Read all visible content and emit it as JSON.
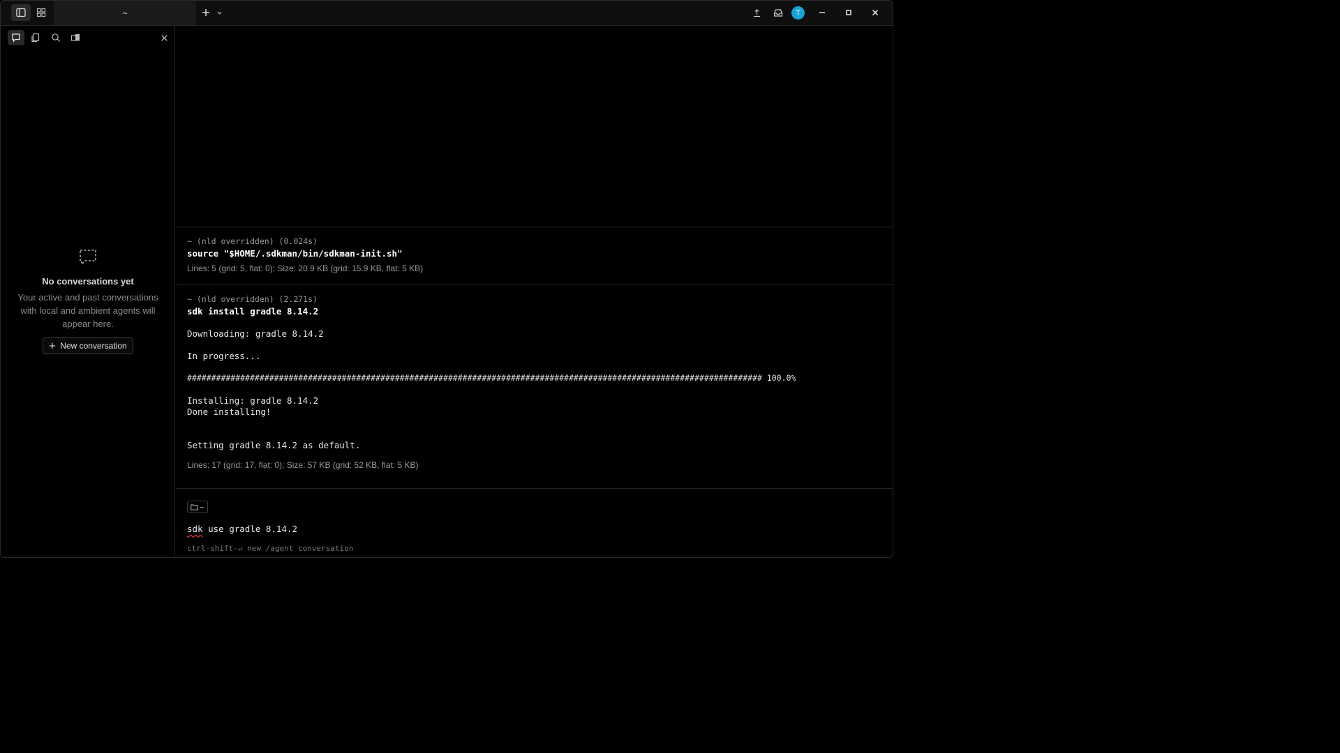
{
  "titlebar": {
    "tab_title": "~",
    "avatar_letter": "T"
  },
  "sidebar": {
    "empty_title": "No conversations yet",
    "empty_desc": "Your active and past conversations with local and ambient agents will appear here.",
    "new_conversation_label": "New conversation"
  },
  "terminal": {
    "blocks": [
      {
        "meta": "~ (nld overridden) (0.024s)",
        "command": "source \"$HOME/.sdkman/bin/sdkman-init.sh\"",
        "stats": "Lines: 5 (grid: 5, flat: 0); Size: 20.9 KB (grid: 15.9 KB, flat: 5 KB)"
      },
      {
        "meta": "~ (nld overridden) (2.271s)",
        "command": "sdk install gradle 8.14.2",
        "output": [
          "Downloading: gradle 8.14.2",
          "In progress...",
          "####################################################################################################################### 100.0%",
          "Installing: gradle 8.14.2",
          "Done installing!",
          "Setting gradle 8.14.2 as default."
        ],
        "stats": "Lines: 17 (grid: 17, flat: 0); Size: 57 KB (grid: 52 KB, flat: 5 KB)"
      }
    ],
    "input": {
      "dir": "~",
      "cmd_word": "sdk",
      "cmd_rest": " use gradle 8.14.2",
      "hint": "ctrl-shift-↵ new /agent conversation"
    }
  }
}
